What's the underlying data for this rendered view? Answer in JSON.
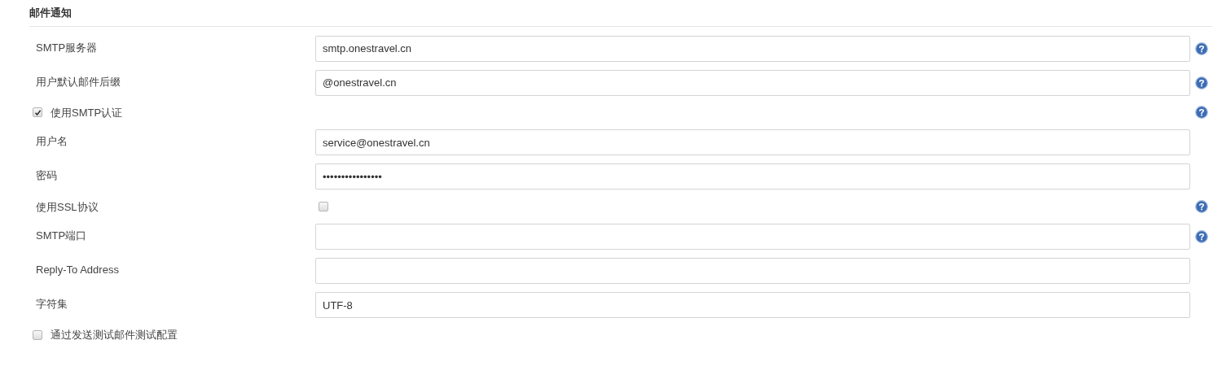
{
  "section": {
    "title": "邮件通知"
  },
  "rows": [
    {
      "kind": "text",
      "label": "SMTP服务器",
      "value": "smtp.onestravel.cn",
      "help": true
    },
    {
      "kind": "text",
      "label": "用户默认邮件后缀",
      "value": "@onestravel.cn",
      "help": true
    },
    {
      "kind": "check",
      "label": "使用SMTP认证",
      "checked": true,
      "help": true
    },
    {
      "kind": "text",
      "label": "用户名",
      "value": "service@onestravel.cn",
      "help": false
    },
    {
      "kind": "text",
      "label": "密码",
      "value": "••••••••••••••••",
      "help": false
    },
    {
      "kind": "toggle",
      "label": "使用SSL协议",
      "checked": false,
      "help": true
    },
    {
      "kind": "text",
      "label": "SMTP端口",
      "help": true
    },
    {
      "kind": "text",
      "label": "Reply-To Address",
      "help": false
    },
    {
      "kind": "text",
      "label": "字符集",
      "value": "UTF-8",
      "help": false
    },
    {
      "kind": "check",
      "label": "通过发送测试邮件测试配置",
      "checked": false,
      "help": false
    }
  ]
}
